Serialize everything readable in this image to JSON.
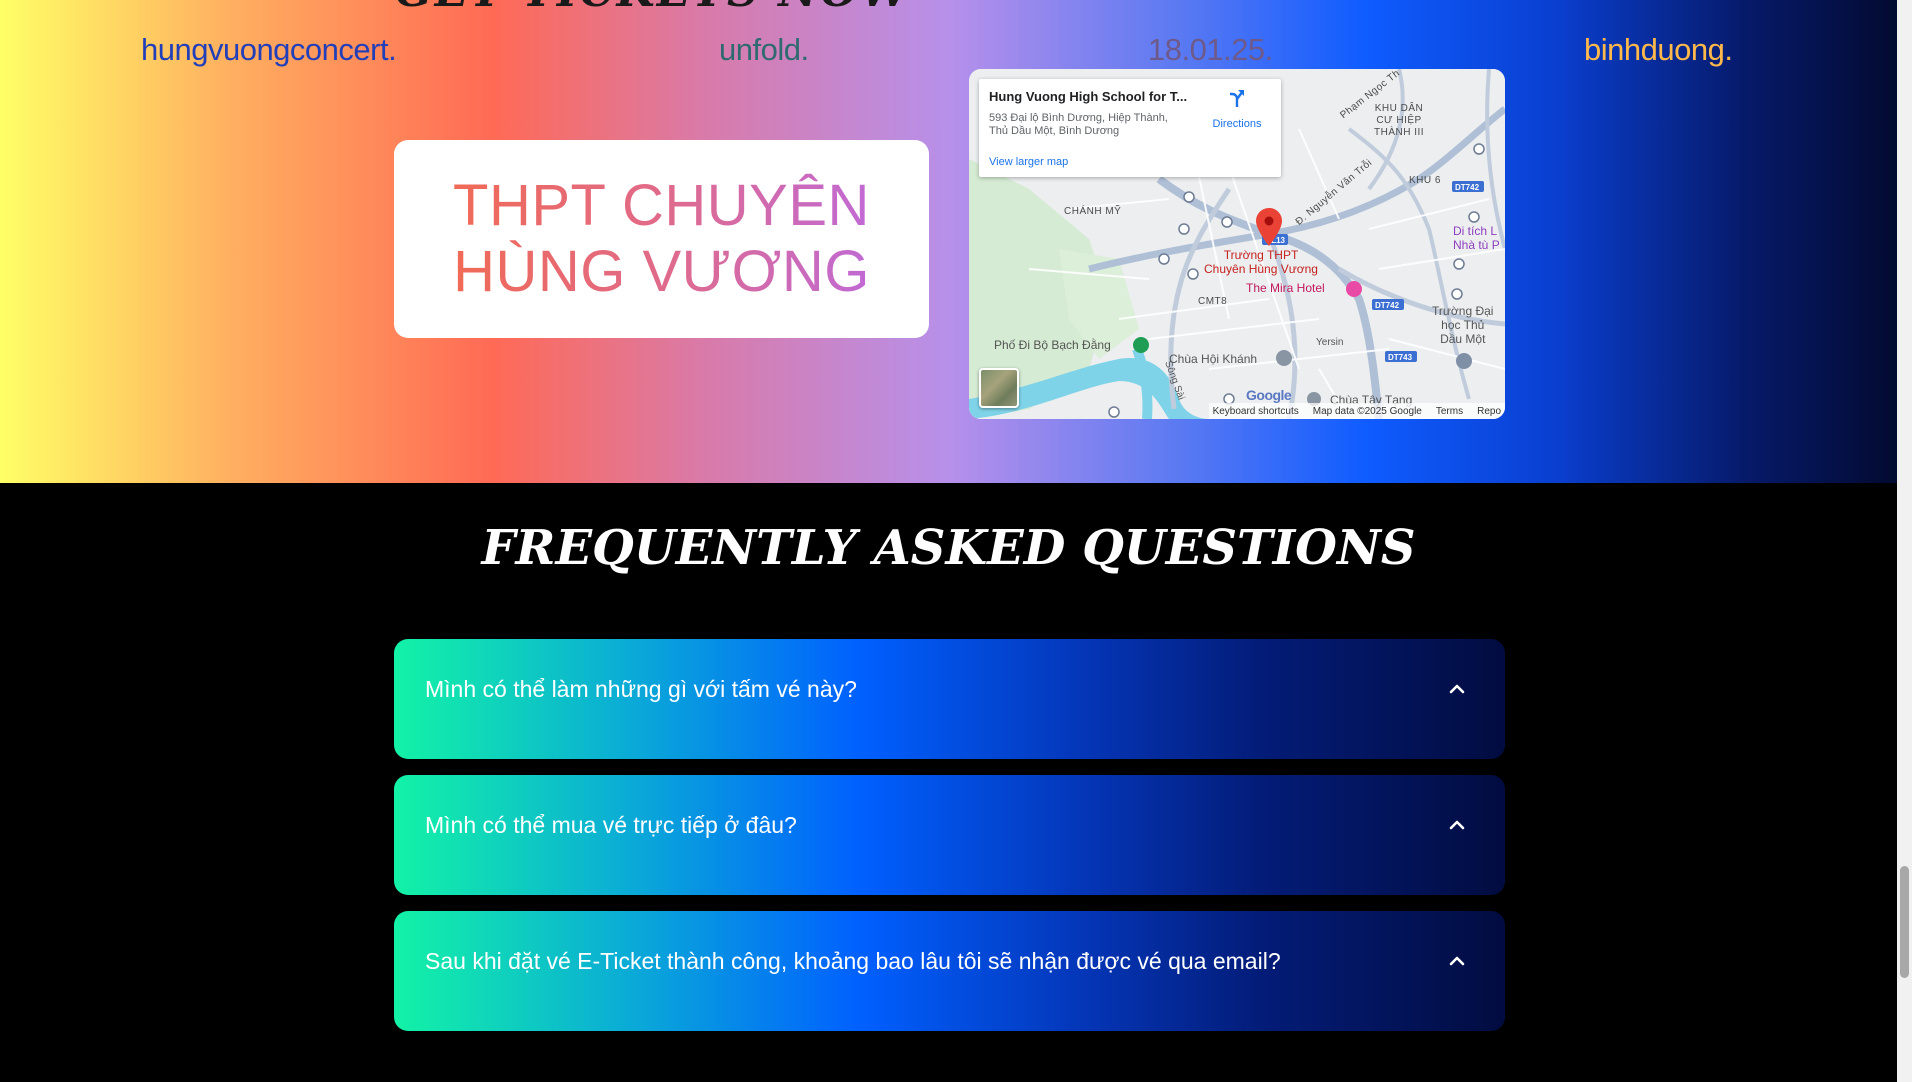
{
  "hero": {
    "cut_heading": "GET TICKETS NOW",
    "info": [
      "hungvuongconcert.",
      "unfold.",
      "18.01.25.",
      "binhduong."
    ],
    "school_line1": "THPT CHUYÊN",
    "school_line2": "HÙNG VƯƠNG"
  },
  "map": {
    "place_title": "Hung Vuong High School for T...",
    "address_line1": "593 Đại lộ Bình Dương, Hiệp Thành,",
    "address_line2": "Thủ Dầu Một, Bình Dương",
    "directions_label": "Directions",
    "larger_map_label": "View larger map",
    "labels": {
      "khu_dan_cu": "KHU DÂN\nCƯ HIỆP\nTHÀNH III",
      "khu6": "KHU 6",
      "chanh_my": "CHÁNH MỸ",
      "cmt8": "CMT8",
      "school": "Trường THPT\nChuyên Hùng Vương",
      "mira": "The Mira Hotel",
      "bach_dang": "Phố Đi Bộ Bạch Đằng",
      "hoi_khanh": "Chùa Hội Khánh",
      "tay_tang": "Chùa Tây Tạng",
      "yersin": "Yersin",
      "pham_ngoc": "Phạm Ngọc Th",
      "nguyen_van_troi": "Đ. Nguyễn Văn Trỗi",
      "di_tich": "Di tích L\nNhà tù P",
      "truong_dai_hoc": "Trường Đại\nhọc Thủ\nDầu Một",
      "song": "Sông Sài",
      "dt742a": "DT742",
      "dt742b": "DT742",
      "dt743": "DT743",
      "ql13": "QL13",
      "google": "Google"
    },
    "footer": [
      "Keyboard shortcuts",
      "Map data ©2025 Google",
      "Terms",
      "Repo"
    ]
  },
  "faq": {
    "title": "FREQUENTLY ASKED QUESTIONS",
    "items": [
      "Mình có thể làm những gì với tấm vé này?",
      "Mình có thể mua vé trực tiếp ở đâu?",
      "Sau khi đặt vé E-Ticket thành công, khoảng bao lâu tôi sẽ nhận được vé qua email?"
    ]
  },
  "colors": {
    "faq_start": "#13f3a6",
    "faq_mid": "#0060ff",
    "faq_end": "#020c40",
    "map_pin": "#ea4335"
  }
}
